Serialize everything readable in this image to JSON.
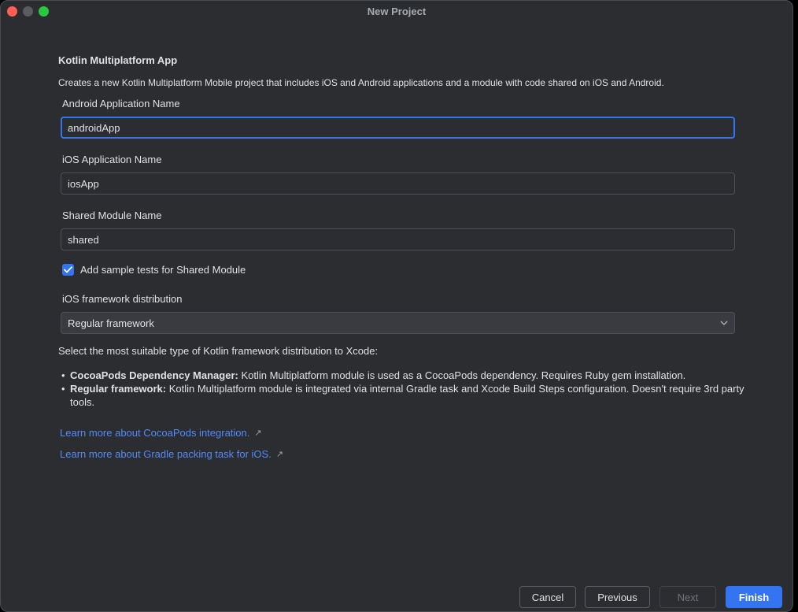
{
  "window": {
    "title": "New Project"
  },
  "header": {
    "title": "Kotlin Multiplatform App",
    "description": "Creates a new Kotlin Multiplatform Mobile project that includes iOS and Android applications and a module with code shared on iOS and Android."
  },
  "form": {
    "android_app_name": {
      "label": "Android Application Name",
      "value": "androidApp"
    },
    "ios_app_name": {
      "label": "iOS Application Name",
      "value": "iosApp"
    },
    "shared_module_name": {
      "label": "Shared Module Name",
      "value": "shared"
    },
    "sample_tests": {
      "label": "Add sample tests for Shared Module",
      "checked": true
    },
    "ios_distribution": {
      "label": "iOS framework distribution",
      "selected": "Regular framework"
    }
  },
  "info": {
    "intro": "Select the most suitable type of Kotlin framework distribution to Xcode:",
    "bullets": [
      {
        "bullet": "•",
        "term": "CocoaPods Dependency Manager:",
        "text": "Kotlin Multiplatform module is used as a CocoaPods dependency. Requires Ruby gem installation."
      },
      {
        "bullet": "•",
        "term": "Regular framework:",
        "text": "Kotlin Multiplatform module is integrated via internal Gradle task and Xcode Build Steps configuration. Doesn't require 3rd party tools."
      }
    ]
  },
  "links": [
    {
      "label": "Learn more about CocoaPods integration.",
      "icon": "external-link-icon",
      "glyph": "↗"
    },
    {
      "label": "Learn more about Gradle packing task for iOS.",
      "icon": "external-link-icon",
      "glyph": "↗"
    }
  ],
  "footer": {
    "cancel": "Cancel",
    "previous": "Previous",
    "next": "Next",
    "finish": "Finish"
  },
  "colors": {
    "accent": "#3574f0",
    "link": "#548af7",
    "background": "#2b2d30"
  }
}
